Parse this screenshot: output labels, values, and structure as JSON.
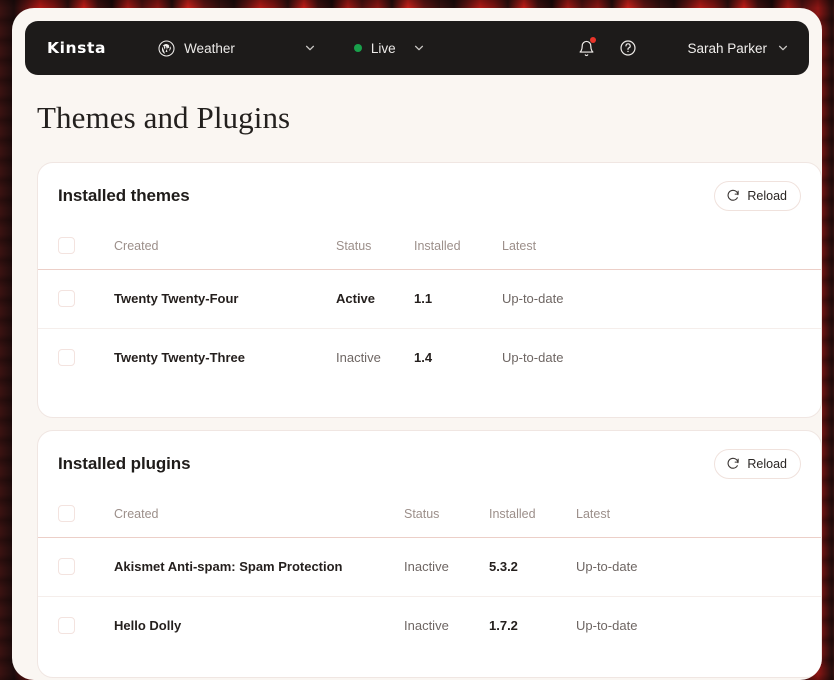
{
  "navbar": {
    "brand": "Kinsta",
    "site": {
      "label": "Weather",
      "icon": "wordpress-icon"
    },
    "environment": {
      "label": "Live",
      "status_color": "#19a04b"
    },
    "notifications_icon": "bell-icon",
    "help_icon": "help-circle-icon",
    "user": {
      "name": "Sarah Parker"
    }
  },
  "page": {
    "title": "Themes and Plugins"
  },
  "themes_card": {
    "title": "Installed themes",
    "reload_label": "Reload",
    "reload_icon": "refresh-icon",
    "columns": [
      "Created",
      "Status",
      "Installed",
      "Latest"
    ],
    "rows": [
      {
        "name": "Twenty Twenty-Four",
        "status": "Active",
        "installed": "1.1",
        "latest": "Up-to-date"
      },
      {
        "name": "Twenty Twenty-Three",
        "status": "Inactive",
        "installed": "1.4",
        "latest": "Up-to-date"
      }
    ]
  },
  "plugins_card": {
    "title": "Installed plugins",
    "reload_label": "Reload",
    "reload_icon": "refresh-icon",
    "columns": [
      "Created",
      "Status",
      "Installed",
      "Latest"
    ],
    "rows": [
      {
        "name": "Akismet Anti-spam: Spam Protection",
        "status": "Inactive",
        "installed": "5.3.2",
        "latest": "Up-to-date"
      },
      {
        "name": "Hello Dolly",
        "status": "Inactive",
        "installed": "1.7.2",
        "latest": "Up-to-date"
      }
    ]
  },
  "theme": {
    "navbar_bg": "#1d1b1a",
    "page_bg": "#faf6f2",
    "card_bg": "#ffffff",
    "accent_divider": "#eccfc8",
    "live_green": "#19a04b",
    "notification_red": "#e8342a"
  }
}
